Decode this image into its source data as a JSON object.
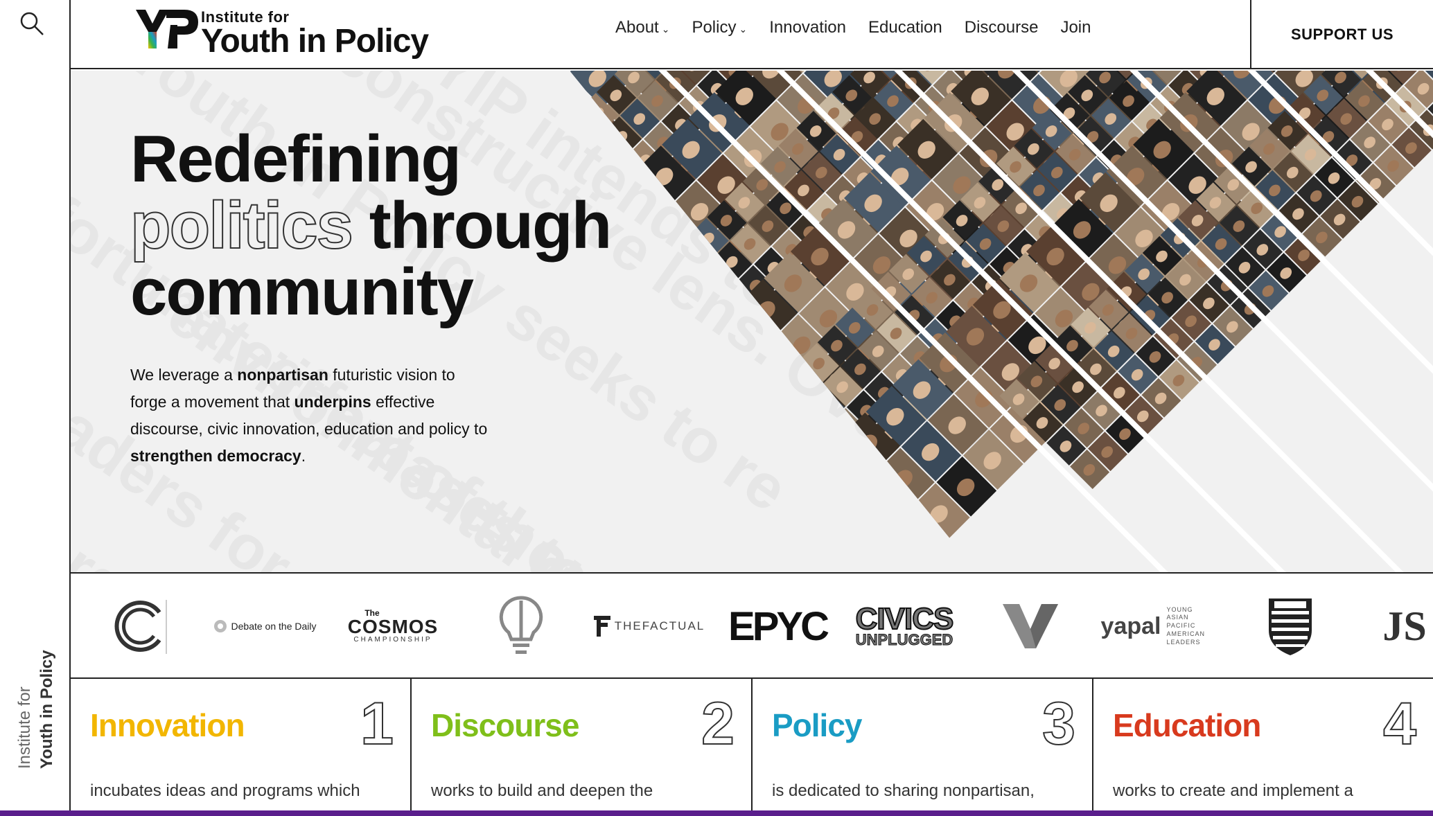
{
  "rail": {
    "vertical_line1": "Institute for",
    "vertical_line2": "Youth in Policy"
  },
  "header": {
    "logo_small": "Institute for",
    "logo_big": "Youth in Policy",
    "nav": [
      {
        "label": "About",
        "has_menu": true
      },
      {
        "label": "Policy",
        "has_menu": true
      },
      {
        "label": "Innovation",
        "has_menu": false
      },
      {
        "label": "Education",
        "has_menu": false
      },
      {
        "label": "Discourse",
        "has_menu": false
      },
      {
        "label": "Join",
        "has_menu": false
      }
    ],
    "support_label": "SUPPORT US"
  },
  "hero": {
    "headline_line1": "Redefining",
    "headline_outline": "politics",
    "headline_line2_rest": "through",
    "headline_line3": "community",
    "lede_1": "We leverage a ",
    "lede_b1": "nonpartisan",
    "lede_2": " futuristic vision to forge a movement that ",
    "lede_b2": "underpins",
    "lede_3": " effective discourse, civic innovation, education and policy to ",
    "lede_b3": "strengthen democracy",
    "lede_4": ".",
    "bg_phrases": [
      "Youth in Policy seeks to re",
      "a constructive lens. Over",
      "YIP intends to increase",
      "fortunate increases to an end",
      "environmental good, with",
      "leaders for youth",
      "effect of though",
      "emerging leaders in"
    ]
  },
  "partners": {
    "debate_label": "Debate on the Daily",
    "cosmos_top": "The",
    "cosmos_main": "COSMOS",
    "cosmos_sub": "CHAMPIONSHIP",
    "factual_label": "THEFACTUAL",
    "epyc_label": "EPYC",
    "civics_line1": "CIVICS",
    "civics_line2": "UNPLUGGED",
    "yapal_label": "yapal",
    "yapal_tag": "YOUNG ASIAN PACIFIC AMERICAN LEADERS",
    "js_label": "JS"
  },
  "pillars": [
    {
      "title": "Innovation",
      "num": "1",
      "color": "#f2b600",
      "desc": "incubates ideas and programs which"
    },
    {
      "title": "Discourse",
      "num": "2",
      "color": "#7fbf1a",
      "desc": "works to build and deepen the"
    },
    {
      "title": "Policy",
      "num": "3",
      "color": "#1a9cc4",
      "desc": "is dedicated to sharing nonpartisan,"
    },
    {
      "title": "Education",
      "num": "4",
      "color": "#d83a1e",
      "desc": "works to create and implement a"
    }
  ],
  "colors": {
    "bottom_bar": "#5a1e8c",
    "logo_gradient": [
      "#f5c400",
      "#38b34a",
      "#1a9cc4",
      "#d83a1e"
    ]
  }
}
